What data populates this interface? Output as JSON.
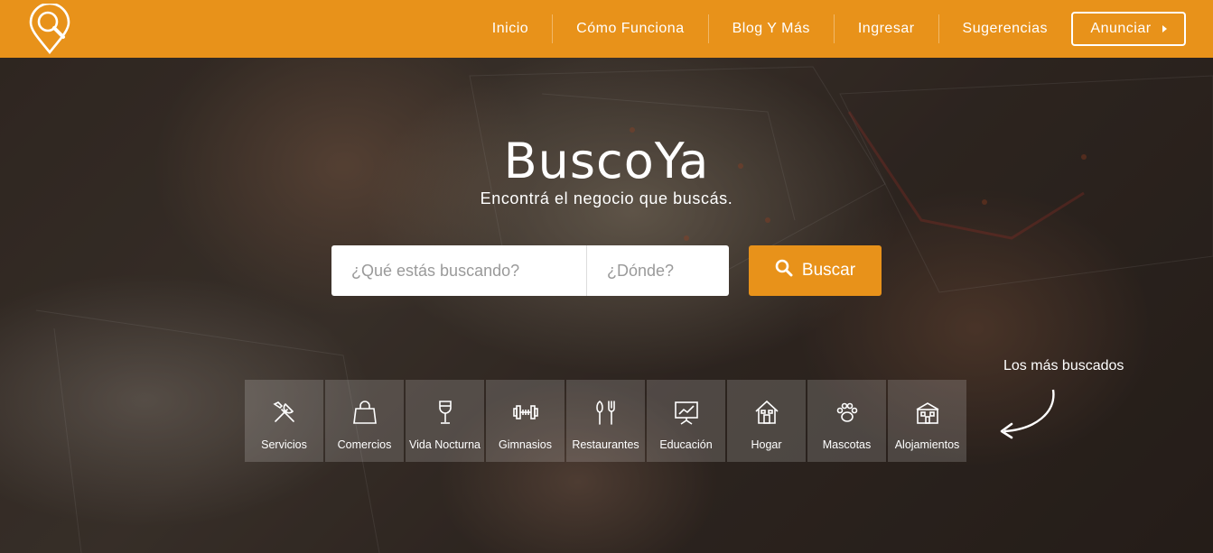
{
  "brand": {
    "name": "BuscoYa",
    "accent": "#e8921a"
  },
  "nav": {
    "items": [
      {
        "label": "Inicio"
      },
      {
        "label": "Cómo Funciona"
      },
      {
        "label": "Blog Y Más"
      },
      {
        "label": "Ingresar"
      },
      {
        "label": "Sugerencias"
      }
    ],
    "cta": "Anunciar"
  },
  "hero": {
    "title": "BuscoYa",
    "subtitle": "Encontrá el negocio que buscás."
  },
  "search": {
    "what_placeholder": "¿Qué estás buscando?",
    "where_placeholder": "¿Dónde?",
    "button": "Buscar"
  },
  "popular": {
    "label": "Los más buscados",
    "categories": [
      {
        "label": "Servicios",
        "icon": "tools-icon"
      },
      {
        "label": "Comercios",
        "icon": "shopping-bag-icon"
      },
      {
        "label": "Vida Nocturna",
        "icon": "wine-glass-icon"
      },
      {
        "label": "Gimnasios",
        "icon": "dumbbell-icon"
      },
      {
        "label": "Restaurantes",
        "icon": "cutlery-icon"
      },
      {
        "label": "Educación",
        "icon": "chalkboard-icon"
      },
      {
        "label": "Hogar",
        "icon": "house-icon"
      },
      {
        "label": "Mascotas",
        "icon": "paw-icon"
      },
      {
        "label": "Alojamientos",
        "icon": "hotel-icon"
      }
    ]
  }
}
